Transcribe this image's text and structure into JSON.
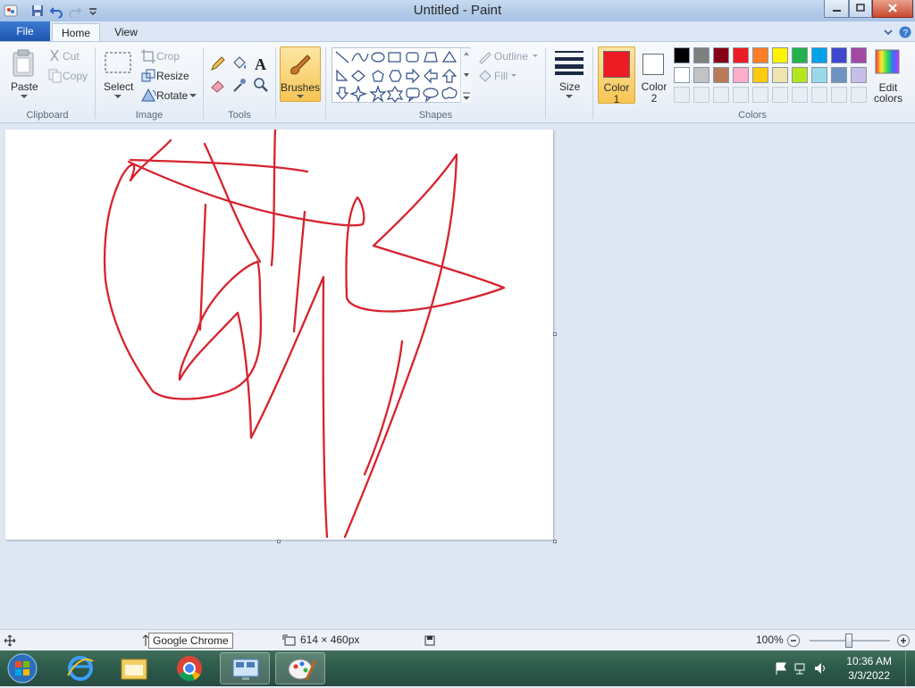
{
  "window": {
    "title": "Untitled - Paint"
  },
  "tabs": {
    "file": "File",
    "home": "Home",
    "view": "View"
  },
  "clipboard": {
    "paste": "Paste",
    "cut": "Cut",
    "copy": "Copy",
    "group": "Clipboard"
  },
  "image": {
    "select": "Select",
    "crop": "Crop",
    "resize": "Resize",
    "rotate": "Rotate",
    "group": "Image"
  },
  "tools": {
    "group": "Tools",
    "text_glyph": "A"
  },
  "brushes": {
    "label": "Brushes"
  },
  "shapes": {
    "outline": "Outline",
    "fill": "Fill",
    "group": "Shapes"
  },
  "size": {
    "label": "Size"
  },
  "colors": {
    "color1": "Color",
    "color1_num": "1",
    "color2": "Color",
    "color2_num": "2",
    "edit1": "Edit",
    "edit2": "colors",
    "group": "Colors",
    "color1_value": "#ed1c24",
    "color2_value": "#ffffff",
    "palette_row1": [
      "#000000",
      "#7f7f7f",
      "#880015",
      "#ed1c24",
      "#ff7f27",
      "#fff200",
      "#22b14c",
      "#00a2e8",
      "#3f48cc",
      "#a349a4"
    ],
    "palette_row2": [
      "#ffffff",
      "#c3c3c3",
      "#b97a57",
      "#ffaec9",
      "#ffc90e",
      "#efe4b0",
      "#b5e61d",
      "#99d9ea",
      "#7092be",
      "#c8bfe7"
    ]
  },
  "status": {
    "dimensions": "614 × 460px",
    "zoom": "100%",
    "tooltip": "Google Chrome"
  },
  "taskbar": {
    "time": "10:36 AM",
    "date": "3/3/2022"
  },
  "stroke_color": "#d6232e"
}
